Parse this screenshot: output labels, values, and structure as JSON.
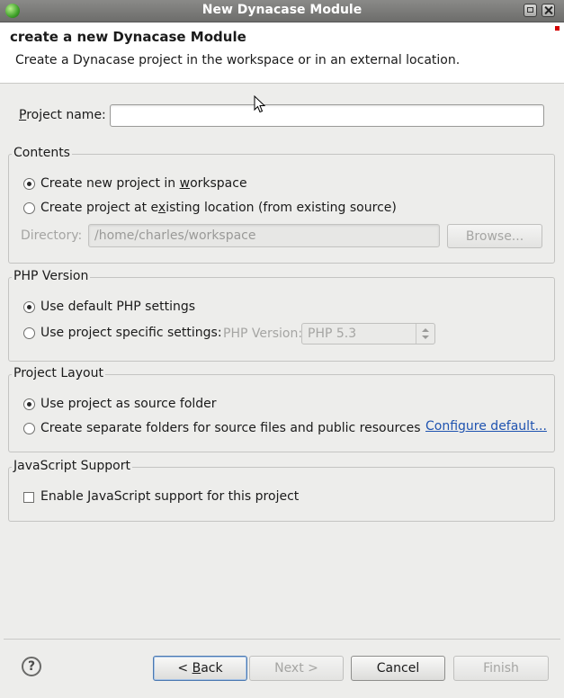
{
  "window": {
    "title": "New Dynacase Module"
  },
  "header": {
    "title": "create a new Dynacase Module",
    "description": "Create a Dynacase project in the workspace or in an external location."
  },
  "project_name": {
    "label_mnemonic": "P",
    "label_rest": "roject name:",
    "value": ""
  },
  "contents": {
    "title": "Contents",
    "option_new_pre": "Create new project in ",
    "option_new_mn": "w",
    "option_new_post": "orkspace",
    "option_new_selected": true,
    "option_existing_pre": "Create project at e",
    "option_existing_mn": "x",
    "option_existing_post": "isting location (from existing source)",
    "option_existing_selected": false,
    "directory_label": "Directory:",
    "directory_value": "/home/charles/workspace",
    "browse_label": "Browse..."
  },
  "php": {
    "title": "PHP Version",
    "option_default": "Use default PHP settings",
    "option_default_selected": true,
    "option_specific": "Use project specific settings:",
    "option_specific_selected": false,
    "version_label": "PHP Version:",
    "version_value": "PHP 5.3"
  },
  "layout": {
    "title": "Project Layout",
    "option_source": "Use project as source folder",
    "option_source_selected": true,
    "option_separate": "Create separate folders for source files and public resources",
    "option_separate_selected": false,
    "configure_link": "Configure default..."
  },
  "javascript": {
    "title": "JavaScript Support",
    "option_enable": "Enable JavaScript support for this project",
    "option_enable_checked": false
  },
  "footer": {
    "help": "?",
    "back_mn": "B",
    "back_pre": "< ",
    "back_rest": "ack",
    "next_label": "Next >",
    "cancel_label": "Cancel",
    "finish_label": "Finish"
  }
}
